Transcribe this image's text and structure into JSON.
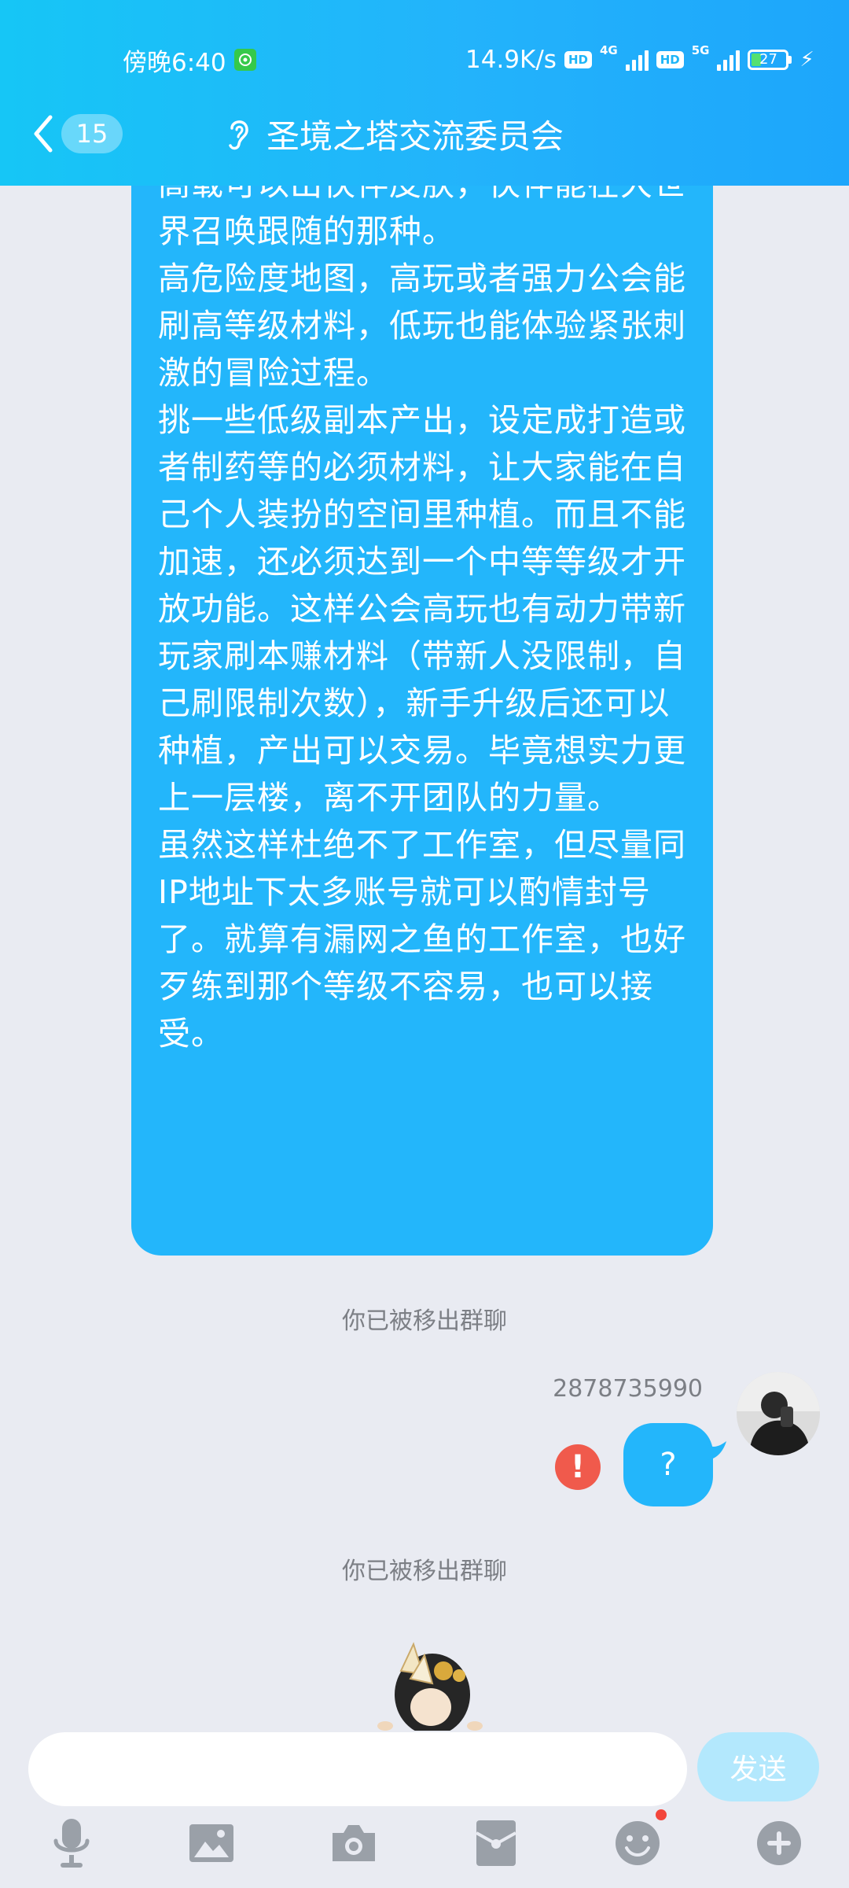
{
  "status_bar": {
    "time": "傍晚6:40",
    "net_speed": "14.9K/s",
    "hd1": "HD",
    "net1": "4G",
    "hd2": "HD",
    "net2": "5G",
    "battery": "27"
  },
  "header": {
    "unread_count": "15",
    "group_name": "圣境之塔交流委员会"
  },
  "messages": {
    "long_text": "高载可以出伙伴皮肤，伙伴能在大世界召唤跟随的那种。\n高危险度地图，高玩或者强力公会能刷高等级材料，低玩也能体验紧张刺激的冒险过程。\n挑一些低级副本产出，设定成打造或者制药等的必须材料，让大家能在自己个人装扮的空间里种植。而且不能加速，还必须达到一个中等等级才开放功能。这样公会高玩也有动力带新玩家刷本赚材料（带新人没限制，自己刷限制次数），新手升级后还可以种植，产出可以交易。毕竟想实力更上一层楼，离不开团队的力量。\n虽然这样杜绝不了工作室，但尽量同IP地址下太多账号就可以酌情封号了。就算有漏网之鱼的工作室，也好歹练到那个等级不容易，也可以接受。",
    "system_note_1": "你已被移出群聊",
    "sender_id": "2878735990",
    "my_message": "?",
    "system_note_2": "你已被移出群聊"
  },
  "input": {
    "placeholder": "",
    "send_label": "发送"
  },
  "colors": {
    "accent": "#23b6fb",
    "background": "#e9ebf2",
    "error": "#f05a4c"
  },
  "toolbar_icons": [
    "mic-icon",
    "image-icon",
    "camera-icon",
    "red-packet-icon",
    "emoji-icon",
    "plus-icon"
  ]
}
